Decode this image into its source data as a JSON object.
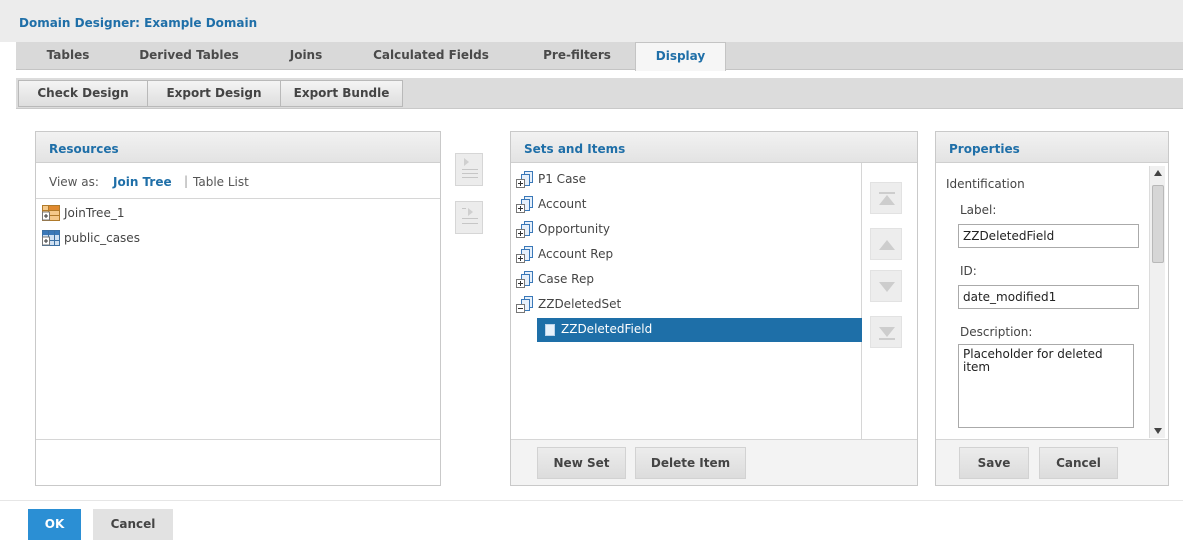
{
  "title": "Domain Designer: Example Domain",
  "tabs": [
    {
      "label": "Tables",
      "active": false
    },
    {
      "label": "Derived Tables",
      "active": false
    },
    {
      "label": "Joins",
      "active": false
    },
    {
      "label": "Calculated Fields",
      "active": false
    },
    {
      "label": "Pre-filters",
      "active": false
    },
    {
      "label": "Display",
      "active": true
    }
  ],
  "toolbar": {
    "check_design": "Check Design",
    "export_design": "Export Design",
    "export_bundle": "Export Bundle"
  },
  "resources": {
    "title": "Resources",
    "view_as_label": "View as:",
    "join_tree_link": "Join Tree",
    "separator": "|",
    "table_list_link": "Table List",
    "items": [
      {
        "label": "JoinTree_1",
        "icon": "join-tree-icon"
      },
      {
        "label": "public_cases",
        "icon": "table-icon"
      }
    ]
  },
  "sets": {
    "title": "Sets and Items",
    "items": [
      {
        "label": "P1 Case",
        "icon": "set-collapsed-icon"
      },
      {
        "label": "Account",
        "icon": "set-collapsed-icon"
      },
      {
        "label": "Opportunity",
        "icon": "set-collapsed-icon"
      },
      {
        "label": "Account Rep",
        "icon": "set-collapsed-icon"
      },
      {
        "label": "Case Rep",
        "icon": "set-collapsed-icon"
      },
      {
        "label": "ZZDeletedSet",
        "icon": "set-expanded-icon"
      }
    ],
    "selected_child": "ZZDeletedField",
    "new_set": "New Set",
    "delete_item": "Delete Item"
  },
  "properties": {
    "title": "Properties",
    "section": "Identification",
    "label_caption": "Label:",
    "label_value": "ZZDeletedField",
    "id_caption": "ID:",
    "id_value": "date_modified1",
    "description_caption": "Description:",
    "description_value": "Placeholder for deleted item",
    "save": "Save",
    "cancel": "Cancel"
  },
  "footer": {
    "ok": "OK",
    "cancel": "Cancel"
  },
  "colors": {
    "accent": "#1f6fa8",
    "selected_row": "#1e6fa8",
    "ok_button": "#2b8fd4"
  }
}
